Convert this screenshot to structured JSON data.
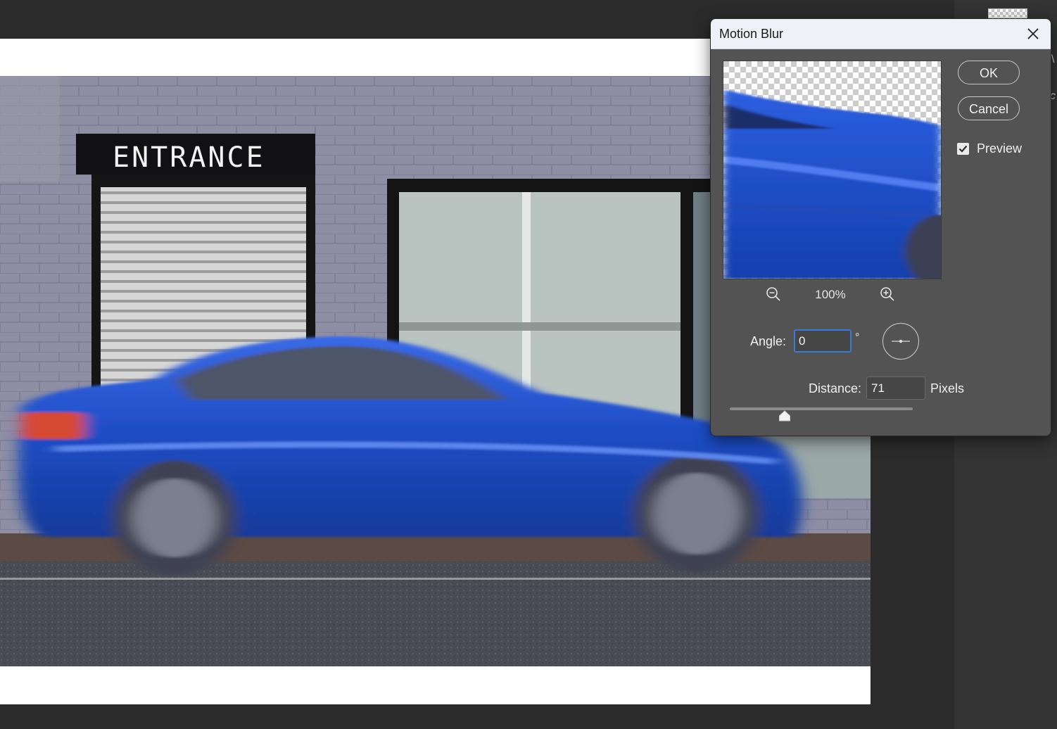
{
  "dialog": {
    "title": "Motion Blur",
    "ok_label": "OK",
    "cancel_label": "Cancel",
    "preview_label": "Preview",
    "preview_checked": true,
    "zoom_level": "100%",
    "angle": {
      "label": "Angle:",
      "value": "0",
      "unit": "°"
    },
    "distance": {
      "label": "Distance:",
      "value": "71",
      "unit": "Pixels",
      "slider_fraction": 0.3
    }
  },
  "canvas": {
    "sign_text": "ENTRANCE"
  },
  "colors": {
    "car_blue": "#1f4fc8",
    "dialog_bg": "#535353",
    "titlebar_bg": "#eef1f7",
    "focus_accent": "#3a7bd5"
  },
  "icons": {
    "close": "close-icon",
    "zoom_out": "zoom-out-icon",
    "zoom_in": "zoom-in-icon",
    "checkbox": "checkmark-icon",
    "angle_dial": "angle-dial-icon"
  }
}
